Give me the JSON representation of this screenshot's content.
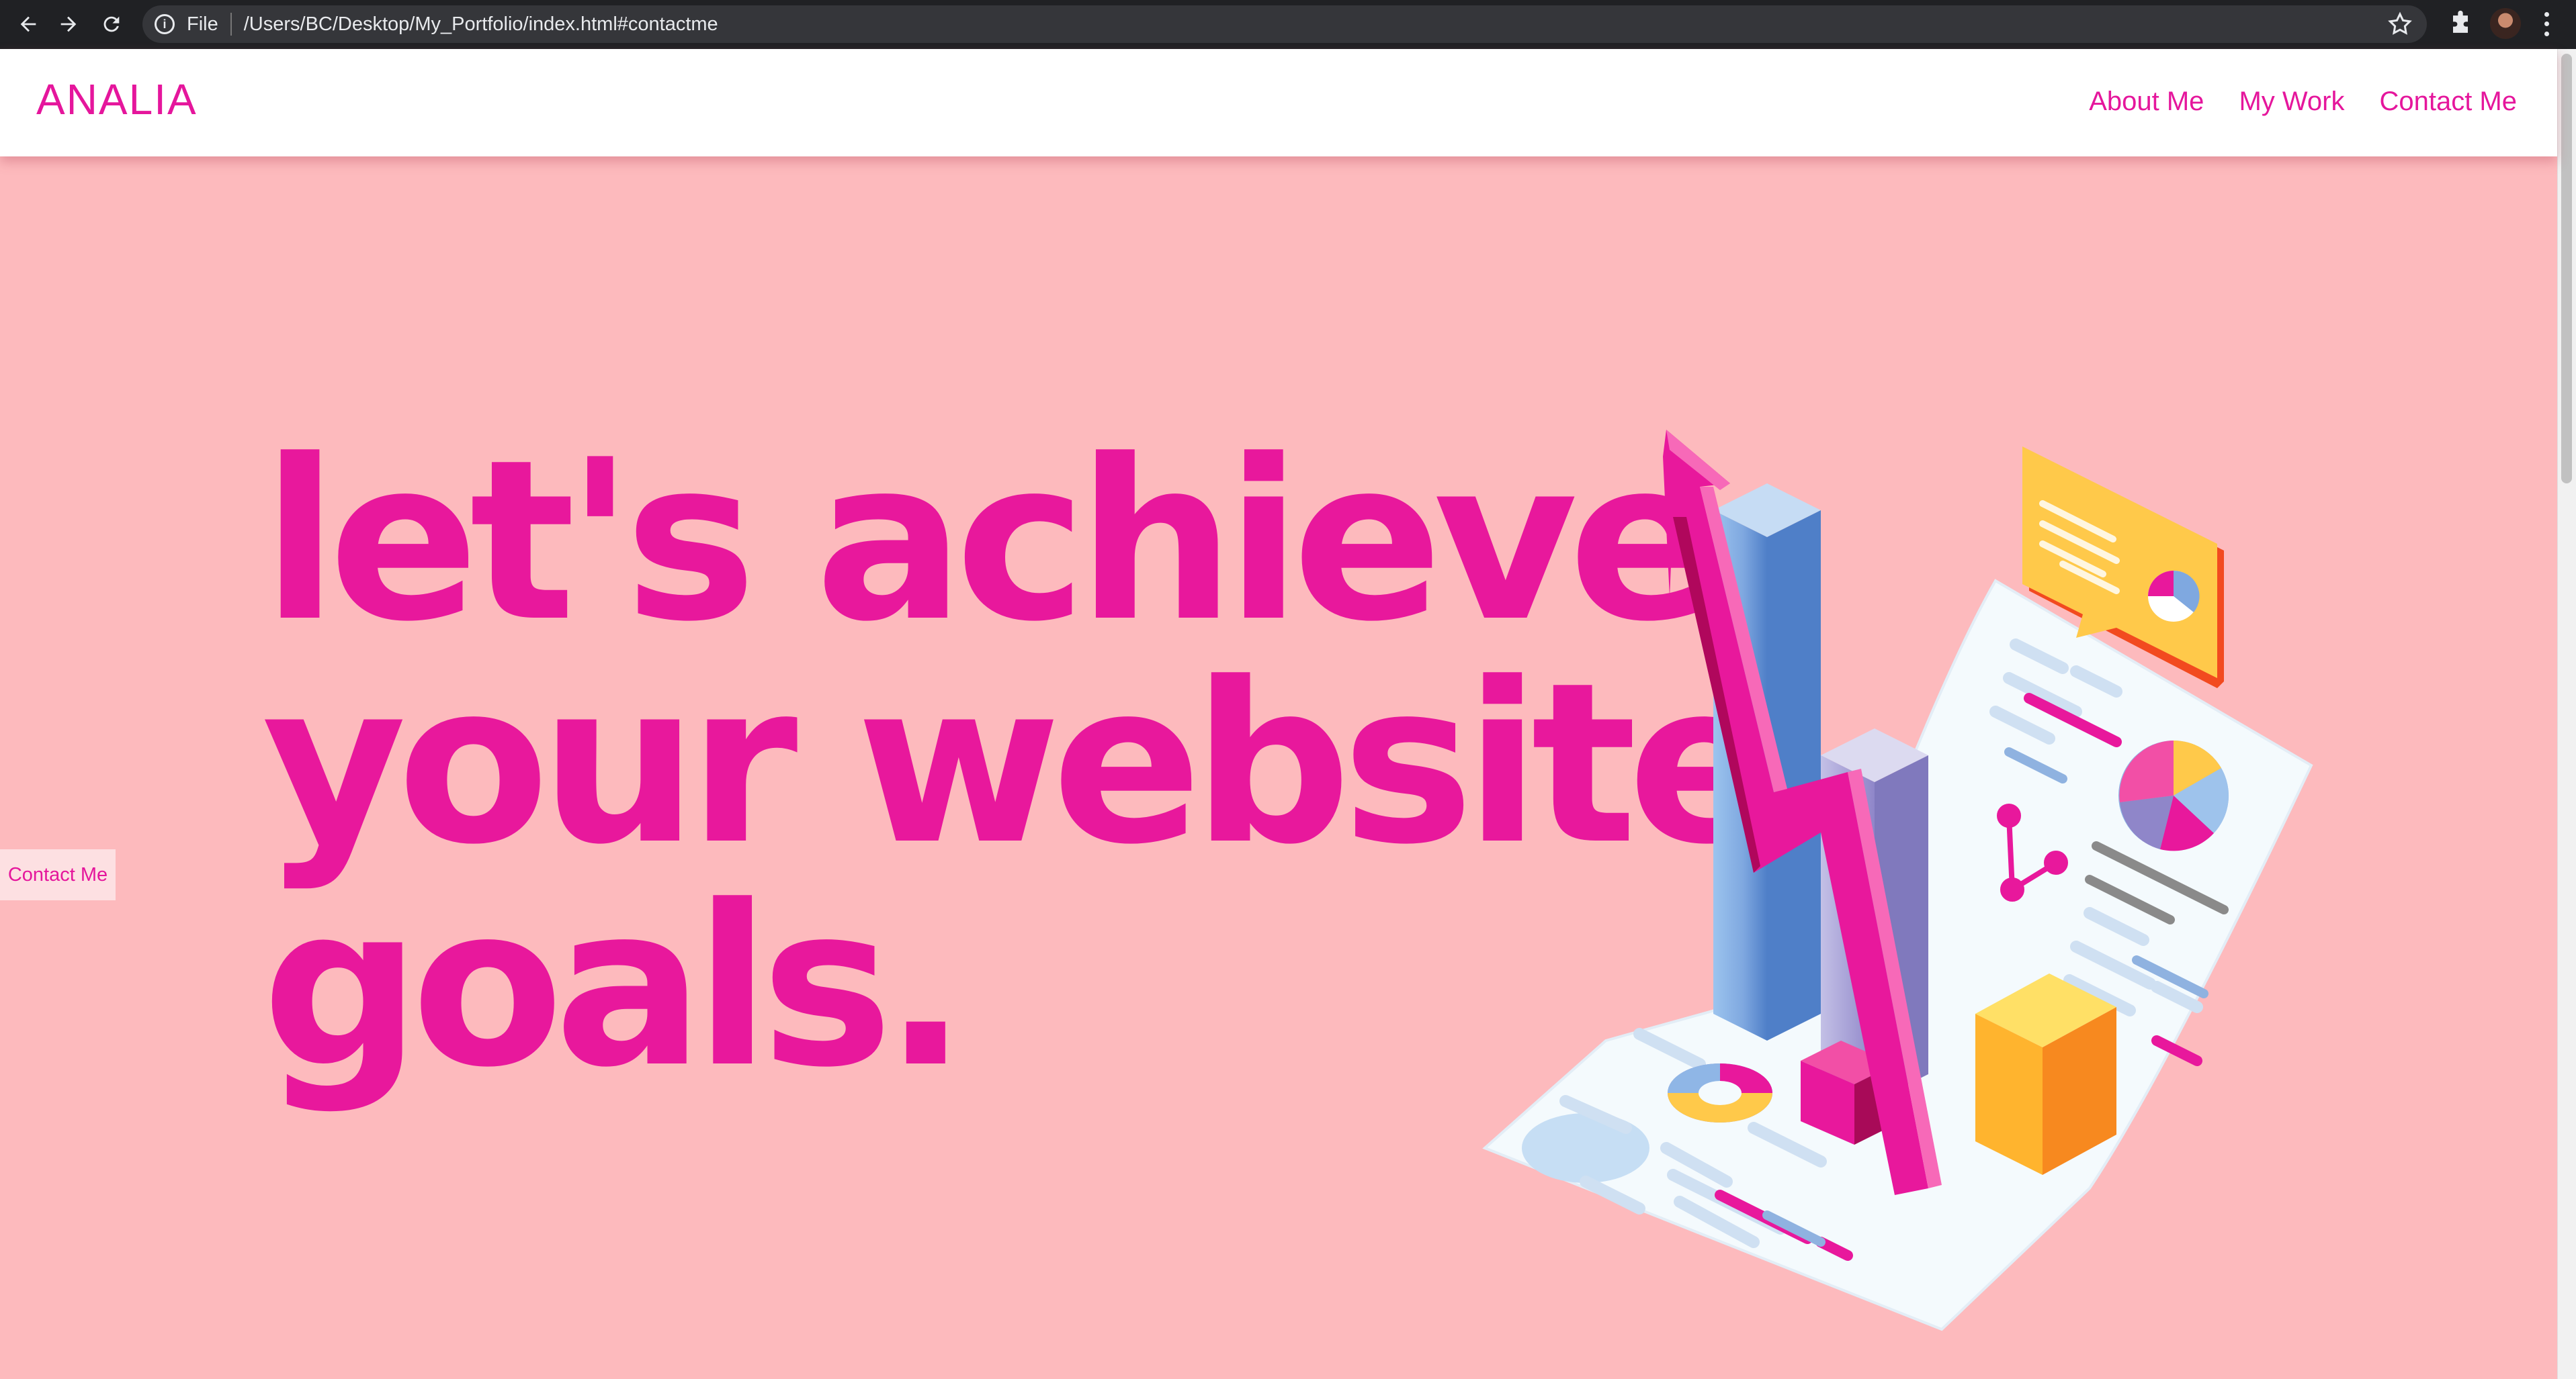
{
  "browser": {
    "url_scheme": "File",
    "url": "/Users/BC/Desktop/My_Portfolio/index.html#contactme",
    "icons": [
      "back-arrow-icon",
      "forward-arrow-icon",
      "reload-icon",
      "info-icon",
      "star-icon",
      "extensions-icon",
      "profile-avatar",
      "more-menu-icon"
    ]
  },
  "header": {
    "logo": "ANALIA",
    "nav": [
      {
        "label": "About Me"
      },
      {
        "label": "My Work"
      },
      {
        "label": "Contact Me"
      }
    ]
  },
  "hero": {
    "line1": "let's achieve",
    "line2": "your website",
    "line3": "goals.",
    "side_button": "Contact Me"
  },
  "colors": {
    "background": "#fdbabd",
    "accent": "#e8189c",
    "header_bg": "#ffffff"
  }
}
